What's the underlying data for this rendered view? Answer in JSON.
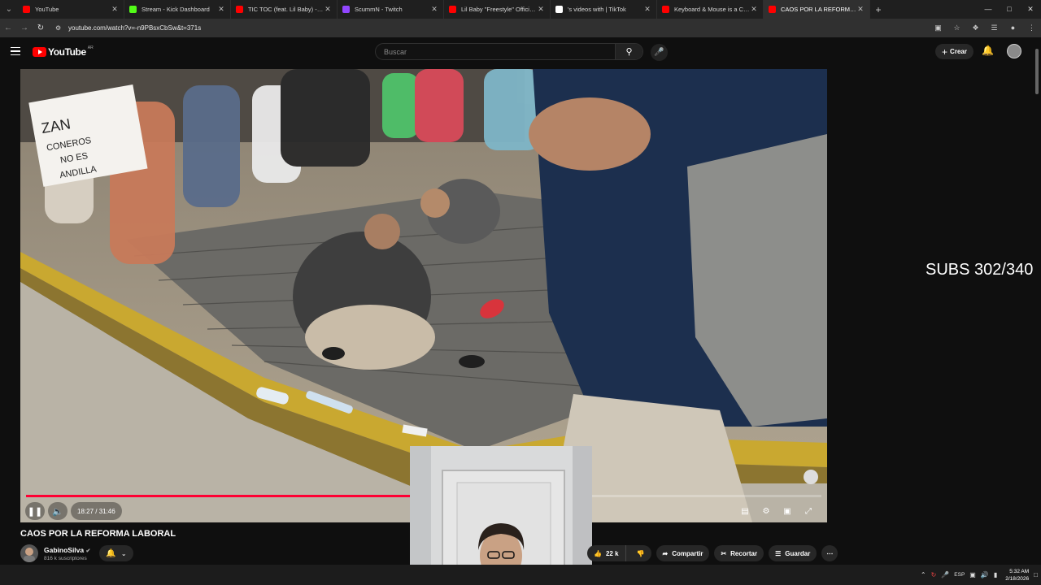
{
  "browser": {
    "tabs": [
      {
        "title": "YouTube",
        "favicon_color": "#ff0000",
        "active": false
      },
      {
        "title": "Stream - Kick Dashboard",
        "favicon_color": "#53fc18",
        "active": false
      },
      {
        "title": "TIC TOC (feat. Lil Baby) - YouTube",
        "favicon_color": "#ff0000",
        "active": false
      },
      {
        "title": "ScummN - Twitch",
        "favicon_color": "#9146ff",
        "active": false
      },
      {
        "title": "Lil Baby \"Freestyle\" Official Mu",
        "favicon_color": "#ff0000",
        "active": false
      },
      {
        "title": "'s videos with | TikTok",
        "favicon_color": "#ffffff",
        "active": false
      },
      {
        "title": "Keyboard & Mouse is a Cheat",
        "favicon_color": "#ff0000",
        "active": false
      },
      {
        "title": "CAOS POR LA REFORMA L",
        "favicon_color": "#ff0000",
        "active": true
      }
    ],
    "url": "youtube.com/watch?v=-n9PBsxCbSw&t=371s"
  },
  "youtube": {
    "logo_text": "YouTube",
    "country_code": "AR",
    "search_placeholder": "Buscar",
    "create_label": "Crear"
  },
  "video": {
    "time_current": "18:27",
    "time_total": "31:46",
    "time_display": "18:27 / 31:46",
    "progress": 0.58,
    "title": "CAOS POR LA REFORMA LABORAL",
    "channel": "GabinoSilva",
    "subscribers": "816 k suscriptores",
    "likes": "22 k",
    "share_label": "Compartir",
    "clip_label": "Recortar",
    "save_label": "Guardar",
    "sign_text": "ZAN CONEROS NO ES ANDILLA"
  },
  "overlay": {
    "subs_counter": "SUBS 302/340"
  },
  "taskbar": {
    "lang": "ESP",
    "time": "5:32 AM",
    "date": "2/18/2026"
  },
  "colors": {
    "accent": "#ff0033",
    "bg": "#0f0f0f"
  }
}
